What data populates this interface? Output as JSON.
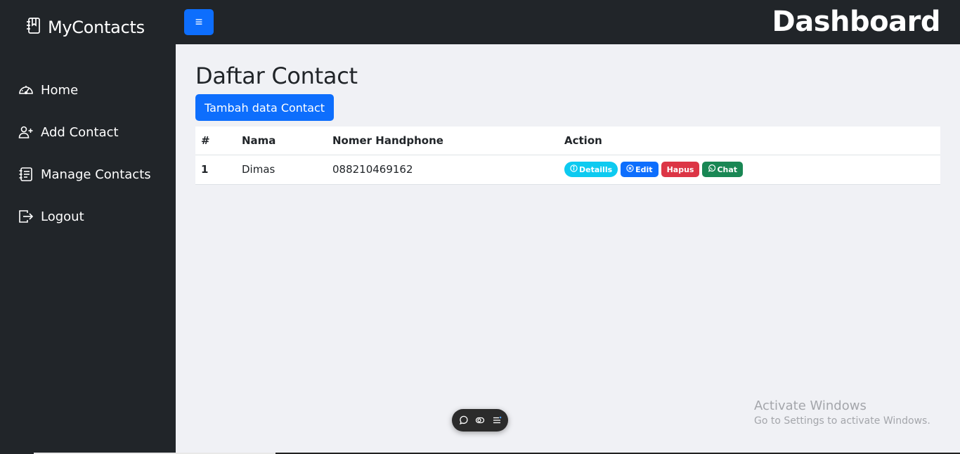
{
  "sidebar": {
    "brand": "MyContacts",
    "items": [
      {
        "label": "Home",
        "icon": "speedometer-icon"
      },
      {
        "label": "Add Contact",
        "icon": "person-plus-icon"
      },
      {
        "label": "Manage Contacts",
        "icon": "journal-text-icon"
      },
      {
        "label": "Logout",
        "icon": "box-arrow-right-icon"
      }
    ]
  },
  "topbar": {
    "toggle_label": "≡",
    "title": "Dashboard"
  },
  "main": {
    "page_title": "Daftar Contact",
    "add_button": "Tambah data Contact",
    "table": {
      "headers": [
        "#",
        "Nama",
        "Nomer Handphone",
        "Action"
      ],
      "rows": [
        {
          "no": "1",
          "nama": "Dimas",
          "hp": "088210469162"
        }
      ],
      "actions": {
        "details": "Detaills",
        "edit": "Edit",
        "hapus": "Hapus",
        "chat": "Chat"
      }
    }
  },
  "watermark": {
    "line1": "Activate Windows",
    "line2": "Go to Settings to activate Windows."
  },
  "colors": {
    "sidebar_bg": "#212529",
    "primary": "#0d6efd",
    "info": "#0dcaf0",
    "danger": "#dc3545",
    "success": "#198754",
    "content_bg": "#f0f1f5"
  }
}
